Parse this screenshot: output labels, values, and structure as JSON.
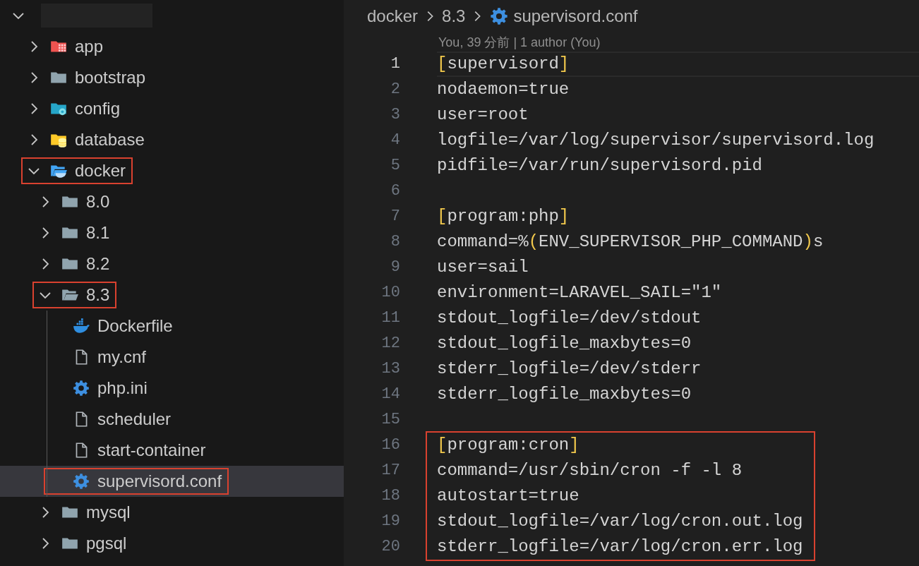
{
  "explorer": {
    "root": {
      "expanded": true,
      "redacted": true,
      "children": [
        {
          "label": "app",
          "kind": "app-folder",
          "expanded": false,
          "highlighted": false,
          "selected": false
        },
        {
          "label": "bootstrap",
          "kind": "folder",
          "expanded": false,
          "highlighted": false,
          "selected": false
        },
        {
          "label": "config",
          "kind": "config-folder",
          "expanded": false,
          "highlighted": false,
          "selected": false
        },
        {
          "label": "database",
          "kind": "database-folder",
          "expanded": false,
          "highlighted": false,
          "selected": false
        },
        {
          "label": "docker",
          "kind": "docker-folder",
          "expanded": true,
          "highlighted": true,
          "selected": false,
          "children": [
            {
              "label": "8.0",
              "kind": "folder",
              "expanded": false,
              "highlighted": false,
              "selected": false
            },
            {
              "label": "8.1",
              "kind": "folder",
              "expanded": false,
              "highlighted": false,
              "selected": false
            },
            {
              "label": "8.2",
              "kind": "folder",
              "expanded": false,
              "highlighted": false,
              "selected": false
            },
            {
              "label": "8.3",
              "kind": "folder",
              "expanded": true,
              "highlighted": true,
              "selected": false,
              "children": [
                {
                  "label": "Dockerfile",
                  "kind": "docker-file",
                  "highlighted": false,
                  "selected": false
                },
                {
                  "label": "my.cnf",
                  "kind": "file",
                  "highlighted": false,
                  "selected": false
                },
                {
                  "label": "php.ini",
                  "kind": "config-file",
                  "highlighted": false,
                  "selected": false
                },
                {
                  "label": "scheduler",
                  "kind": "file",
                  "highlighted": false,
                  "selected": false
                },
                {
                  "label": "start-container",
                  "kind": "file",
                  "highlighted": false,
                  "selected": false
                },
                {
                  "label": "supervisord.conf",
                  "kind": "config-file",
                  "highlighted": true,
                  "selected": true
                }
              ]
            },
            {
              "label": "mysql",
              "kind": "folder",
              "expanded": false,
              "highlighted": false,
              "selected": false
            },
            {
              "label": "pgsql",
              "kind": "folder",
              "expanded": false,
              "highlighted": false,
              "selected": false
            }
          ]
        }
      ]
    }
  },
  "editor": {
    "breadcrumb": [
      {
        "label": "docker",
        "kind": "folder"
      },
      {
        "label": "8.3",
        "kind": "folder"
      },
      {
        "label": "supervisord.conf",
        "kind": "config-file"
      }
    ],
    "blame": "You, 39 分前 | 1 author (You)",
    "lines": [
      {
        "number": "1",
        "current": true,
        "highlighted": false,
        "segments": [
          {
            "text": "[",
            "kind": "bracket"
          },
          {
            "text": "supervisord",
            "kind": "plain"
          },
          {
            "text": "]",
            "kind": "bracket"
          }
        ]
      },
      {
        "number": "2",
        "current": false,
        "highlighted": false,
        "segments": [
          {
            "text": "nodaemon=true",
            "kind": "plain"
          }
        ]
      },
      {
        "number": "3",
        "current": false,
        "highlighted": false,
        "segments": [
          {
            "text": "user=root",
            "kind": "plain"
          }
        ]
      },
      {
        "number": "4",
        "current": false,
        "highlighted": false,
        "segments": [
          {
            "text": "logfile=/var/log/supervisor/supervisord.log",
            "kind": "plain"
          }
        ]
      },
      {
        "number": "5",
        "current": false,
        "highlighted": false,
        "segments": [
          {
            "text": "pidfile=/var/run/supervisord.pid",
            "kind": "plain"
          }
        ]
      },
      {
        "number": "6",
        "current": false,
        "highlighted": false
      },
      {
        "number": "7",
        "current": false,
        "highlighted": false,
        "segments": [
          {
            "text": "[",
            "kind": "bracket"
          },
          {
            "text": "program:php",
            "kind": "plain"
          },
          {
            "text": "]",
            "kind": "bracket"
          }
        ]
      },
      {
        "number": "8",
        "current": false,
        "highlighted": false,
        "segments": [
          {
            "text": "command=%",
            "kind": "plain"
          },
          {
            "text": "(",
            "kind": "bracket"
          },
          {
            "text": "ENV_SUPERVISOR_PHP_COMMAND",
            "kind": "plain"
          },
          {
            "text": ")",
            "kind": "bracket"
          },
          {
            "text": "s",
            "kind": "plain"
          }
        ]
      },
      {
        "number": "9",
        "current": false,
        "highlighted": false,
        "segments": [
          {
            "text": "user=sail",
            "kind": "plain"
          }
        ]
      },
      {
        "number": "10",
        "current": false,
        "highlighted": false,
        "segments": [
          {
            "text": "environment=LARAVEL_SAIL=\"1\"",
            "kind": "plain"
          }
        ]
      },
      {
        "number": "11",
        "current": false,
        "highlighted": false,
        "segments": [
          {
            "text": "stdout_logfile=/dev/stdout",
            "kind": "plain"
          }
        ]
      },
      {
        "number": "12",
        "current": false,
        "highlighted": false,
        "segments": [
          {
            "text": "stdout_logfile_maxbytes=0",
            "kind": "plain"
          }
        ]
      },
      {
        "number": "13",
        "current": false,
        "highlighted": false,
        "segments": [
          {
            "text": "stderr_logfile=/dev/stderr",
            "kind": "plain"
          }
        ]
      },
      {
        "number": "14",
        "current": false,
        "highlighted": false,
        "segments": [
          {
            "text": "stderr_logfile_maxbytes=0",
            "kind": "plain"
          }
        ]
      },
      {
        "number": "15",
        "current": false,
        "highlighted": false
      },
      {
        "number": "16",
        "current": false,
        "highlighted": true,
        "segments": [
          {
            "text": "[",
            "kind": "bracket"
          },
          {
            "text": "program:cron",
            "kind": "plain"
          },
          {
            "text": "]",
            "kind": "bracket"
          }
        ]
      },
      {
        "number": "17",
        "current": false,
        "highlighted": true,
        "segments": [
          {
            "text": "command=/usr/sbin/cron -f -l 8",
            "kind": "plain"
          }
        ]
      },
      {
        "number": "18",
        "current": false,
        "highlighted": true,
        "segments": [
          {
            "text": "autostart=true",
            "kind": "plain"
          }
        ]
      },
      {
        "number": "19",
        "current": false,
        "highlighted": true,
        "segments": [
          {
            "text": "stdout_logfile=/var/log/cron.out.log",
            "kind": "plain"
          }
        ]
      },
      {
        "number": "20",
        "current": false,
        "highlighted": true,
        "segments": [
          {
            "text": "stderr_logfile=/var/log/cron.err.log",
            "kind": "plain"
          }
        ]
      }
    ]
  }
}
